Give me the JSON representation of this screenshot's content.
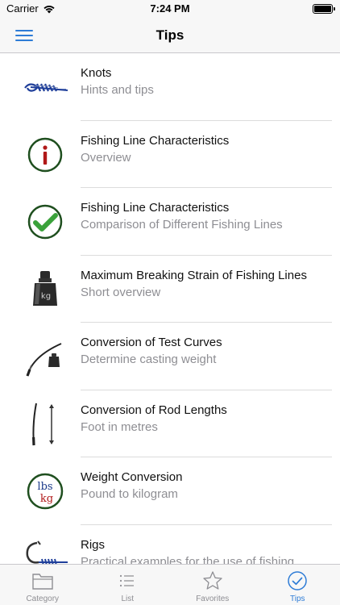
{
  "status_bar": {
    "carrier": "Carrier",
    "time": "7:24 PM"
  },
  "nav": {
    "title": "Tips"
  },
  "rows": [
    {
      "title": "Knots",
      "subtitle": "Hints and tips",
      "icon": "knot-icon"
    },
    {
      "title": "Fishing Line Characteristics",
      "subtitle": "Overview",
      "icon": "info-icon"
    },
    {
      "title": "Fishing Line Characteristics",
      "subtitle": "Comparison of Different Fishing Lines",
      "icon": "checkmark-icon"
    },
    {
      "title": "Maximum Breaking Strain of Fishing Lines",
      "subtitle": "Short overview",
      "icon": "weight-icon"
    },
    {
      "title": "Conversion of Test Curves",
      "subtitle": "Determine casting weight",
      "icon": "rod-weight-icon"
    },
    {
      "title": "Conversion of Rod Lengths",
      "subtitle": "Foot in metres",
      "icon": "rod-length-icon"
    },
    {
      "title": "Weight Conversion",
      "subtitle": "Pound to kilogram",
      "icon": "lbs-kg-icon"
    },
    {
      "title": "Rigs",
      "subtitle": "Practical examples for the use of fishing",
      "icon": "hook-icon"
    }
  ],
  "weight_icon_text": "kg",
  "lbs_text": "lbs",
  "kg_text": "kg",
  "tabs": [
    {
      "label": "Category",
      "icon": "folder-icon"
    },
    {
      "label": "List",
      "icon": "list-icon"
    },
    {
      "label": "Favorites",
      "icon": "star-icon"
    },
    {
      "label": "Tips",
      "icon": "check-circle-icon",
      "active": true
    }
  ],
  "colors": {
    "accent": "#2e7cd6",
    "icon_green": "#2b8a2b",
    "icon_dark_green": "#1f4f1f",
    "icon_red": "#b01818",
    "icon_navy": "#1a3a8a"
  }
}
